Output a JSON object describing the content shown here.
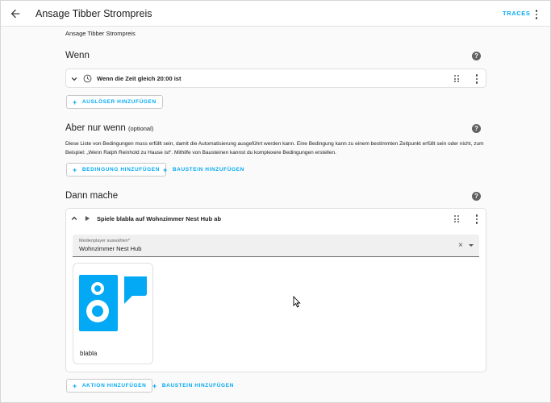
{
  "header": {
    "title": "Ansage Tibber Strompreis",
    "traces_label": "TRACES"
  },
  "automation_name": "Ansage Tibber Strompreis",
  "help_glyph": "?",
  "triggers": {
    "title": "Wenn",
    "items": [
      {
        "label": "Wenn die Zeit gleich 20:00 ist",
        "icon": "clock-icon"
      }
    ],
    "add_label": "AUSLÖSER HINZUFÜGEN"
  },
  "conditions": {
    "title": "Aber nur wenn",
    "optional": "(optional)",
    "description": "Diese Liste von Bedingungen muss erfüllt sein, damit die Automatisierung ausgeführt werden kann. Eine Bedingung kann zu einem bestimmten Zeitpunkt erfüllt sein oder nicht, zum Beispiel: „Wenn Ralph Reinhold zu Hause ist“. Mithilfe von Bausteinen kannst du komplexere Bedingungen erstellen.",
    "add_label": "BEDINGUNG HINZUFÜGEN",
    "add_block_label": "BAUSTEIN HINZUFÜGEN"
  },
  "actions": {
    "title": "Dann mache",
    "items": [
      {
        "label": "Spiele blabla auf Wohnzimmer Nest Hub ab",
        "icon": "play-icon",
        "media_player": {
          "field_label": "Medienplayer auswählen*",
          "value": "Wohnzimmer Nest Hub",
          "clear_glyph": "×"
        },
        "media_item": {
          "name": "blabla",
          "icon": "speaker-message-icon"
        }
      }
    ],
    "add_label": "AKTION HINZUFÜGEN",
    "add_block_label": "BAUSTEIN HINZUFÜGEN"
  },
  "colors": {
    "accent": "#03a9f4",
    "background": "#fafafa",
    "card": "#ffffff"
  }
}
